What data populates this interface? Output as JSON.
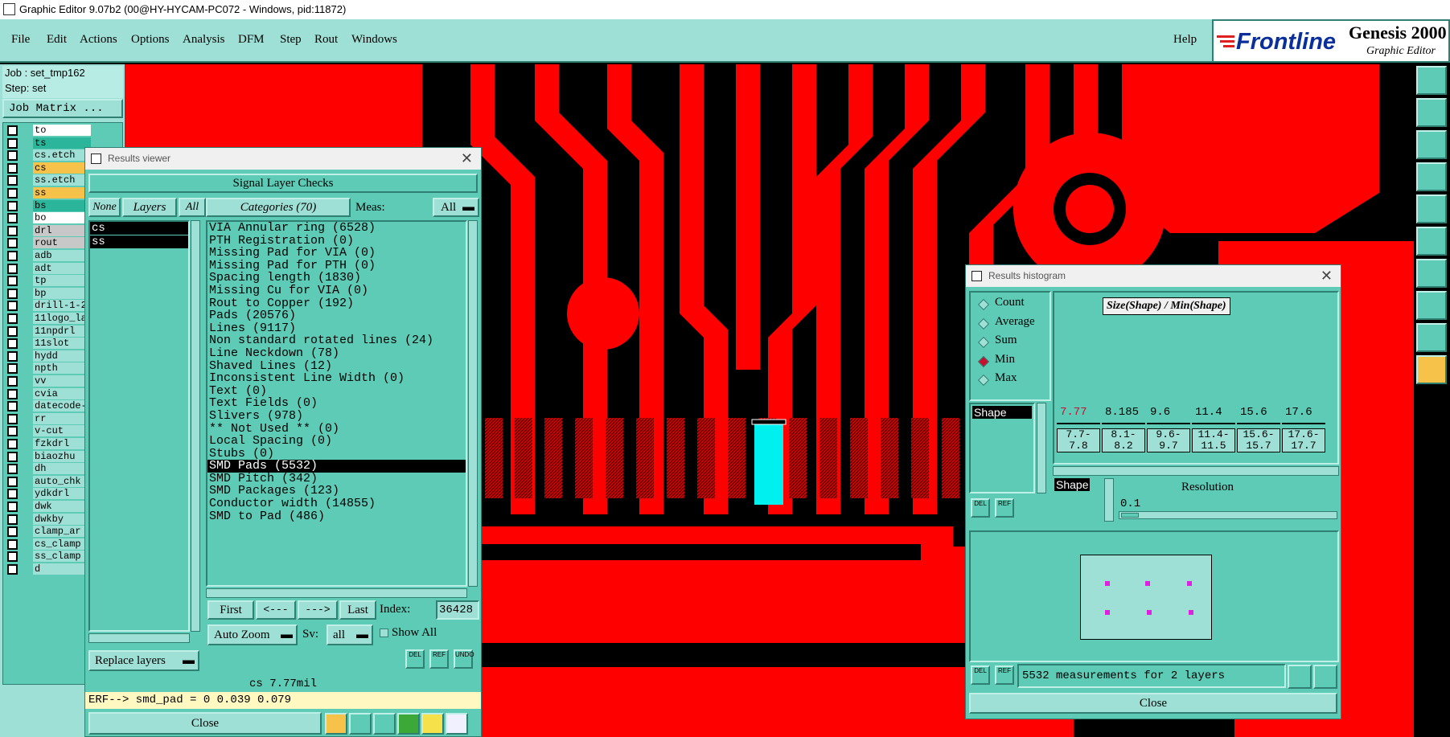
{
  "window": {
    "title": "Graphic Editor 9.07b2 (00@HY-HYCAM-PC072 - Windows, pid:11872)"
  },
  "menu": {
    "items": [
      "File",
      "Edit",
      "Actions",
      "Options",
      "Analysis",
      "DFM",
      "Step",
      "Rout",
      "Windows"
    ],
    "help": "Help"
  },
  "logo": {
    "brand": "Frontline",
    "product": "Genesis 2000",
    "subtitle": "Graphic Editor"
  },
  "left_panel": {
    "job": "Job : set_tmp162",
    "step": "Step: set",
    "job_matrix": "Job Matrix ...",
    "layers": [
      {
        "name": "to",
        "color": "#ffffff"
      },
      {
        "name": "ts",
        "color": "#2bb59a"
      },
      {
        "name": "cs.etch",
        "color": "#9fe0d6"
      },
      {
        "name": "cs",
        "color": "#f7c24a"
      },
      {
        "name": "ss.etch",
        "color": "#9fe0d6"
      },
      {
        "name": "ss",
        "color": "#f7c24a"
      },
      {
        "name": "bs",
        "color": "#2bb59a"
      },
      {
        "name": "bo",
        "color": "#ffffff"
      },
      {
        "name": "drl",
        "color": "#c8c8c8"
      },
      {
        "name": "rout",
        "color": "#c8c8c8"
      },
      {
        "name": "adb",
        "color": "#9fe0d6"
      },
      {
        "name": "adt",
        "color": "#9fe0d6"
      },
      {
        "name": "tp",
        "color": "#9fe0d6"
      },
      {
        "name": "bp",
        "color": "#9fe0d6"
      },
      {
        "name": "drill-1-2",
        "color": "#9fe0d6"
      },
      {
        "name": "11logo_la",
        "color": "#9fe0d6"
      },
      {
        "name": "11npdrl",
        "color": "#9fe0d6"
      },
      {
        "name": "11slot",
        "color": "#9fe0d6"
      },
      {
        "name": "hydd",
        "color": "#9fe0d6"
      },
      {
        "name": "npth",
        "color": "#9fe0d6"
      },
      {
        "name": "vv",
        "color": "#9fe0d6"
      },
      {
        "name": "cvia",
        "color": "#9fe0d6"
      },
      {
        "name": "datecode-",
        "color": "#9fe0d6"
      },
      {
        "name": "rr",
        "color": "#9fe0d6"
      },
      {
        "name": "v-cut",
        "color": "#9fe0d6"
      },
      {
        "name": "fzkdrl",
        "color": "#9fe0d6"
      },
      {
        "name": "biaozhu",
        "color": "#9fe0d6"
      },
      {
        "name": "dh",
        "color": "#9fe0d6"
      },
      {
        "name": "auto_chk",
        "color": "#9fe0d6"
      },
      {
        "name": "ydkdrl",
        "color": "#9fe0d6"
      },
      {
        "name": "dwk",
        "color": "#9fe0d6"
      },
      {
        "name": "dwkby",
        "color": "#9fe0d6"
      },
      {
        "name": "clamp_ar",
        "color": "#9fe0d6"
      },
      {
        "name": "cs_clamp",
        "color": "#9fe0d6"
      },
      {
        "name": "ss_clamp",
        "color": "#9fe0d6"
      },
      {
        "name": "d",
        "color": "#9fe0d6"
      }
    ]
  },
  "results_viewer": {
    "title": "Results viewer",
    "header": "Signal Layer Checks",
    "none_btn": "None",
    "layers_btn": "Layers",
    "all_btn": "All",
    "categories_btn": "Categories (70)",
    "meas_label": "Meas:",
    "meas_value": "All",
    "layers": [
      "cs",
      "ss"
    ],
    "categories": [
      "VIA Annular ring (6528)",
      "PTH Registration (0)",
      "Missing Pad for VIA (0)",
      "Missing Pad for PTH (0)",
      "Spacing length (1830)",
      "Missing Cu for VIA (0)",
      "Rout to Copper (192)",
      "Pads (20576)",
      "Lines (9117)",
      "Non standard rotated lines (24)",
      "Line Neckdown (78)",
      "Shaved Lines (12)",
      "Inconsistent Line Width (0)",
      "Text (0)",
      "Text Fields (0)",
      "Slivers (978)",
      "** Not Used ** (0)",
      "Local Spacing (0)",
      "Stubs (0)",
      "SMD Pads (5532)",
      "SMD Pitch (342)",
      "SMD Packages (123)",
      "Conductor width (14855)",
      "SMD to Pad (486)"
    ],
    "selected_category": 19,
    "nav": {
      "first": "First",
      "prev": "<---",
      "next": "--->",
      "last": "Last",
      "index_label": "Index:",
      "index_value": "36428"
    },
    "auto_zoom": "Auto Zoom",
    "sv_label": "Sv:",
    "sv_value": "all",
    "show_all": "Show All",
    "replace_layers": "Replace layers",
    "status": "cs 7.77mil",
    "erf": "ERF--> smd_pad = 0 0.039 0.079",
    "close": "Close",
    "icon_labels": {
      "del": "DEL",
      "ref": "REF",
      "undo": "UNDO"
    }
  },
  "histogram": {
    "title": "Results histogram",
    "modes": [
      "Count",
      "Average",
      "Sum",
      "Min",
      "Max"
    ],
    "selected_mode": "Min",
    "heading": "Size(Shape) / Min(Shape)",
    "list_item": "Shape",
    "bins": [
      {
        "value": "7.77",
        "range": "7.7-\n7.8",
        "highlight": true
      },
      {
        "value": "8.185",
        "range": "8.1-\n8.2",
        "highlight": false
      },
      {
        "value": "9.6",
        "range": "9.6-\n9.7",
        "highlight": false
      },
      {
        "value": "11.4",
        "range": "11.4-\n11.5",
        "highlight": false
      },
      {
        "value": "15.6",
        "range": "15.6-\n15.7",
        "highlight": false
      },
      {
        "value": "17.6",
        "range": "17.6-\n17.7",
        "highlight": false
      }
    ],
    "shape_label": "Shape",
    "resolution_label": "Resolution",
    "resolution_value": "0.1",
    "status": "5532 measurements for 2 layers",
    "close": "Close",
    "icon_labels": {
      "del": "DEL",
      "ref": "REF"
    }
  },
  "colors": {
    "copper": "#ff0000",
    "highlight": "#00f0f0",
    "panel": "#5ecbb6",
    "panel_light": "#9fe0d6",
    "selected_text": "#c8102e"
  }
}
